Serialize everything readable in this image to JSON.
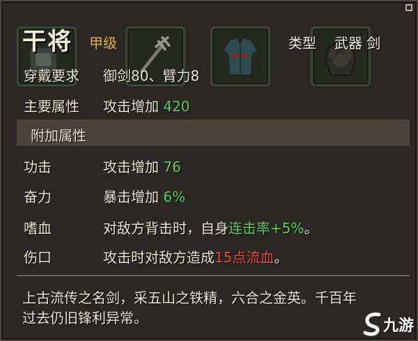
{
  "item": {
    "name": "干将",
    "grade": "甲级",
    "type_label": "类型",
    "type_value": "武器 剑"
  },
  "requirements": {
    "label": "穿戴要求",
    "value": "御剑80、臂力8"
  },
  "main_attribute": {
    "label": "主要属性",
    "text": "攻击增加",
    "number": "420"
  },
  "extra_attributes": {
    "title": "附加属性",
    "rows": [
      {
        "label": "功击",
        "text": "攻击增加",
        "number": "76"
      },
      {
        "label": "奋力",
        "text": "暴击增加",
        "number": "6%"
      },
      {
        "label": "嗜血",
        "text": "对敌方背击时，自身",
        "highlight": "连击率+5%",
        "suffix": "。"
      },
      {
        "label": "伤口",
        "text": "攻击时对敌方造成",
        "highlight": "15点流血",
        "suffix": "。"
      }
    ]
  },
  "description": {
    "line1": "上古流传之名剑，采五山之铁精，六合之金英。千百年",
    "line2": "过去仍旧锋利异常。"
  },
  "watermark": {
    "text": "九游"
  },
  "colors": {
    "panel_bg": "#2b2724",
    "grade": "#d9b23e",
    "positive": "#5fcd5b",
    "bleed": "#e84a3c"
  },
  "icons": [
    "item-slot-1-icon",
    "trident-icon",
    "robe-icon",
    "armor-icon",
    "corner-close-icon",
    "jiuyou-logo-icon"
  ]
}
